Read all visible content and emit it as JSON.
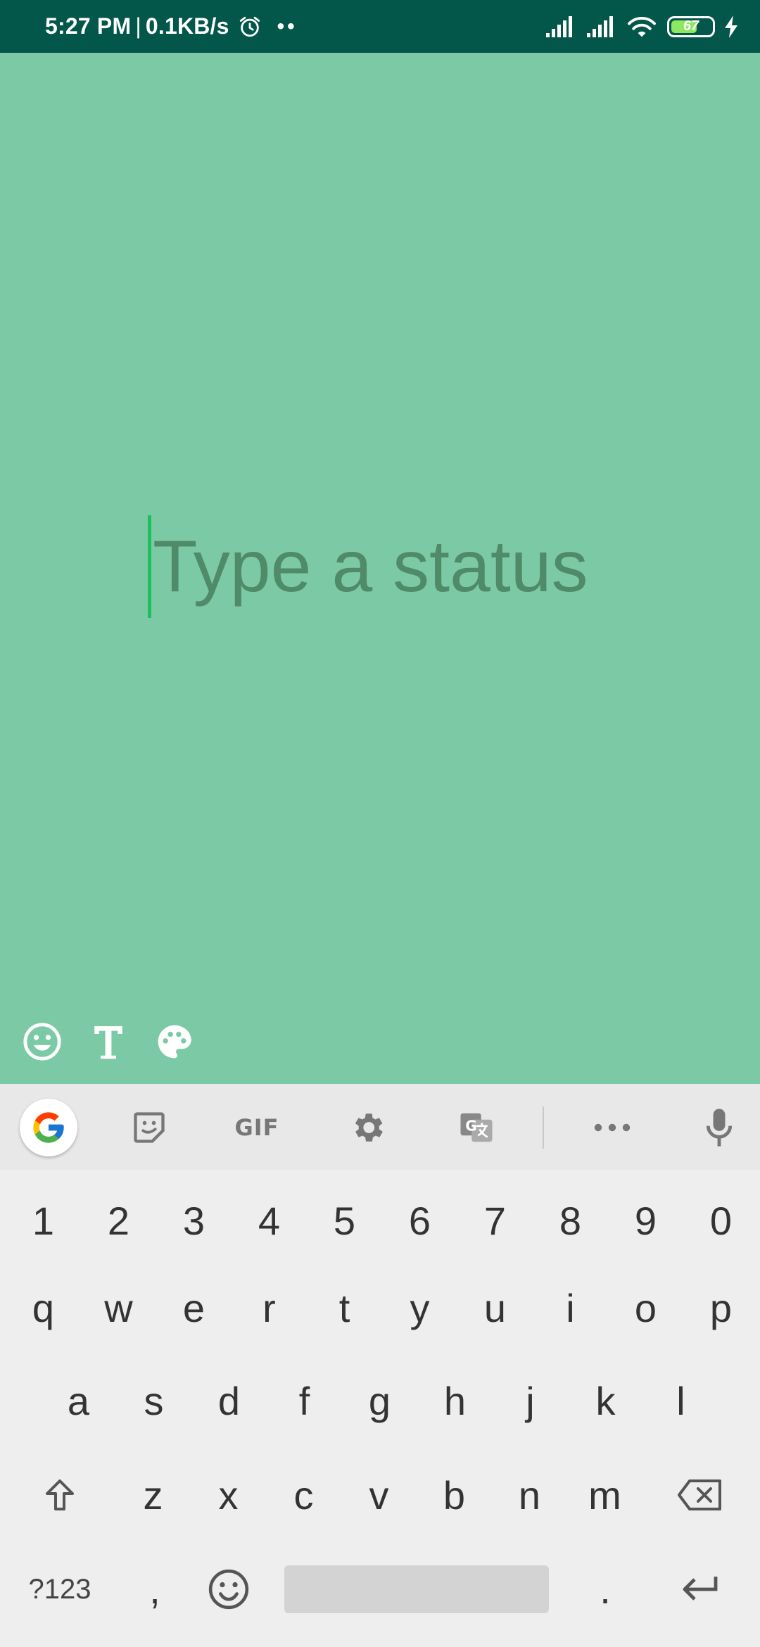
{
  "status_bar": {
    "time": "5:27 PM",
    "separator": "|",
    "speed": "0.1KB/s",
    "dots": "••",
    "battery_level": "67",
    "battery_fraction": 0.67
  },
  "composer": {
    "placeholder": "Type a status",
    "background_color": "#7ccaa5",
    "tools": [
      "emoji-icon",
      "text-style-icon",
      "palette-icon"
    ]
  },
  "keyboard": {
    "toolbar": {
      "items": [
        "google-icon",
        "sticker-icon",
        "gif",
        "settings-icon",
        "translate-icon",
        "more-icon",
        "mic-icon"
      ],
      "gif_label": "GIF"
    },
    "number_row": [
      "1",
      "2",
      "3",
      "4",
      "5",
      "6",
      "7",
      "8",
      "9",
      "0"
    ],
    "row1": [
      "q",
      "w",
      "e",
      "r",
      "t",
      "y",
      "u",
      "i",
      "o",
      "p"
    ],
    "row2": [
      "a",
      "s",
      "d",
      "f",
      "g",
      "h",
      "j",
      "k",
      "l"
    ],
    "row3": [
      "z",
      "x",
      "c",
      "v",
      "b",
      "n",
      "m"
    ],
    "bottom": {
      "symbols": "?123",
      "comma": ",",
      "period": "."
    }
  }
}
